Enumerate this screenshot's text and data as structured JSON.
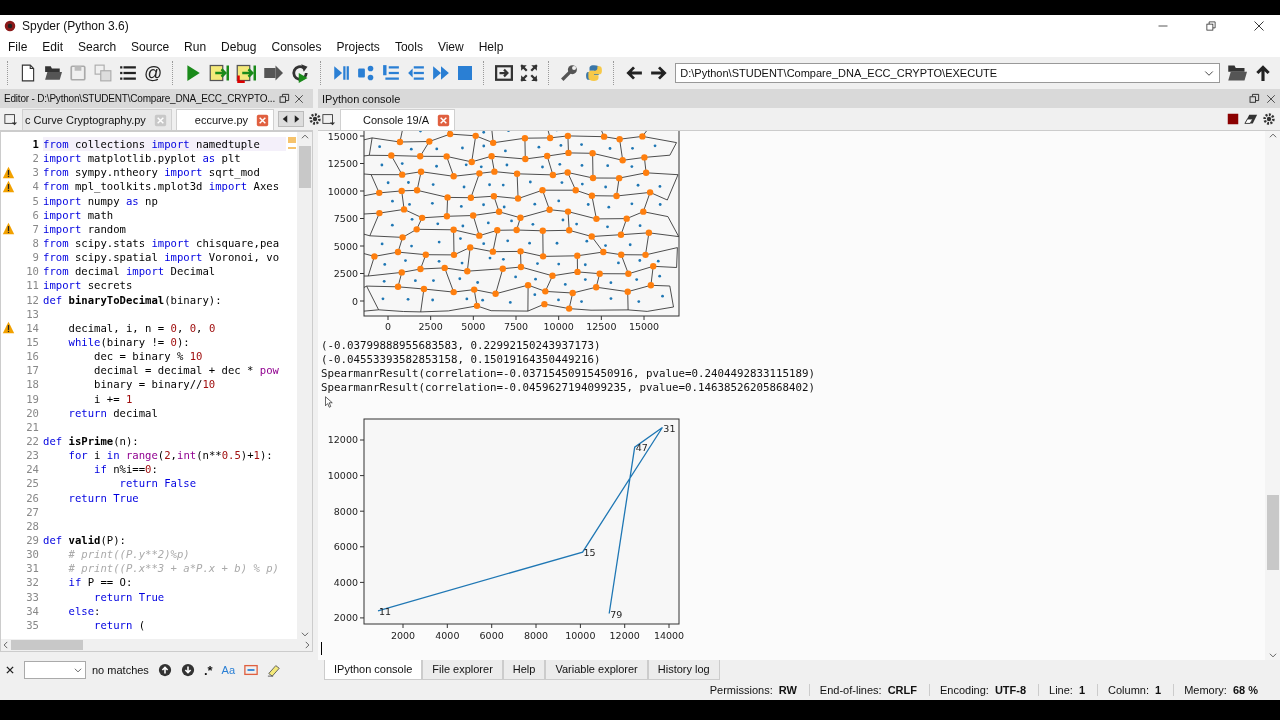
{
  "window": {
    "title": "Spyder (Python 3.6)"
  },
  "menu": [
    "File",
    "Edit",
    "Search",
    "Source",
    "Run",
    "Debug",
    "Consoles",
    "Projects",
    "Tools",
    "View",
    "Help"
  ],
  "toolbar": {
    "email_symbol": "@",
    "working_directory": "D:\\Python\\STUDENT\\Compare_DNA_ECC_CRYPTO\\EXECUTE"
  },
  "editor": {
    "title": "Editor - D:\\Python\\STUDENT\\Compare_DNA_ECC_CRYPTO...",
    "tabs": [
      {
        "label": "c Curve Cryptography.py",
        "selected": false
      },
      {
        "label": "eccurve.py",
        "selected": true
      }
    ],
    "lines": [
      {
        "n": "1",
        "current": true,
        "warning": false,
        "s": [
          {
            "t": "from",
            "kind": "keyword"
          },
          {
            "t": " collections "
          },
          {
            "t": "import",
            "kind": "keyword"
          },
          {
            "t": " namedtuple"
          }
        ]
      },
      {
        "n": "2",
        "current": false,
        "warning": false,
        "s": [
          {
            "t": "import",
            "kind": "keyword"
          },
          {
            "t": " matplotlib.pyplot "
          },
          {
            "t": "as",
            "kind": "keyword"
          },
          {
            "t": " plt"
          }
        ]
      },
      {
        "n": "3",
        "current": false,
        "warning": true,
        "s": [
          {
            "t": "from",
            "kind": "keyword"
          },
          {
            "t": " sympy.ntheory "
          },
          {
            "t": "import",
            "kind": "keyword"
          },
          {
            "t": " sqrt_mod"
          }
        ]
      },
      {
        "n": "4",
        "current": false,
        "warning": true,
        "s": [
          {
            "t": "from",
            "kind": "keyword"
          },
          {
            "t": " mpl_toolkits.mplot3d "
          },
          {
            "t": "import",
            "kind": "keyword"
          },
          {
            "t": " Axes"
          }
        ]
      },
      {
        "n": "5",
        "current": false,
        "warning": false,
        "s": [
          {
            "t": "import",
            "kind": "keyword"
          },
          {
            "t": " numpy "
          },
          {
            "t": "as",
            "kind": "keyword"
          },
          {
            "t": " np"
          }
        ]
      },
      {
        "n": "6",
        "current": false,
        "warning": false,
        "s": [
          {
            "t": "import",
            "kind": "keyword"
          },
          {
            "t": " math"
          }
        ]
      },
      {
        "n": "7",
        "current": false,
        "warning": true,
        "s": [
          {
            "t": "import",
            "kind": "keyword"
          },
          {
            "t": " random"
          }
        ]
      },
      {
        "n": "8",
        "current": false,
        "warning": false,
        "s": [
          {
            "t": "from",
            "kind": "keyword"
          },
          {
            "t": " scipy.stats "
          },
          {
            "t": "import",
            "kind": "keyword"
          },
          {
            "t": " chisquare,pea"
          }
        ]
      },
      {
        "n": "9",
        "current": false,
        "warning": false,
        "s": [
          {
            "t": "from",
            "kind": "keyword"
          },
          {
            "t": " scipy.spatial "
          },
          {
            "t": "import",
            "kind": "keyword"
          },
          {
            "t": " Voronoi, vo"
          }
        ]
      },
      {
        "n": "10",
        "current": false,
        "warning": false,
        "s": [
          {
            "t": "from",
            "kind": "keyword"
          },
          {
            "t": " decimal "
          },
          {
            "t": "import",
            "kind": "keyword"
          },
          {
            "t": " Decimal"
          }
        ]
      },
      {
        "n": "11",
        "current": false,
        "warning": false,
        "s": [
          {
            "t": "import",
            "kind": "keyword"
          },
          {
            "t": " secrets"
          }
        ]
      },
      {
        "n": "12",
        "current": false,
        "warning": false,
        "s": [
          {
            "t": "def ",
            "kind": "keyword"
          },
          {
            "t": "binaryToDecimal",
            "kind": "name"
          },
          {
            "t": "(binary):"
          }
        ]
      },
      {
        "n": "13",
        "current": false,
        "warning": false
      },
      {
        "n": "14",
        "current": false,
        "warning": true,
        "s": [
          {
            "t": "    decimal, i, n = "
          },
          {
            "t": "0",
            "kind": "number"
          },
          {
            "t": ", "
          },
          {
            "t": "0",
            "kind": "number"
          },
          {
            "t": ", "
          },
          {
            "t": "0",
            "kind": "number"
          }
        ]
      },
      {
        "n": "15",
        "current": false,
        "warning": false,
        "s": [
          {
            "t": "    while",
            "kind": "keyword"
          },
          {
            "t": "(binary != "
          },
          {
            "t": "0",
            "kind": "number"
          },
          {
            "t": "):"
          }
        ]
      },
      {
        "n": "16",
        "current": false,
        "warning": false,
        "s": [
          {
            "t": "        dec = binary % "
          },
          {
            "t": "10",
            "kind": "number"
          }
        ]
      },
      {
        "n": "17",
        "current": false,
        "warning": false,
        "s": [
          {
            "t": "        decimal = decimal + dec * "
          },
          {
            "t": "pow",
            "kind": "builtin"
          }
        ]
      },
      {
        "n": "18",
        "current": false,
        "warning": false,
        "s": [
          {
            "t": "        binary = binary//"
          },
          {
            "t": "10",
            "kind": "number"
          }
        ]
      },
      {
        "n": "19",
        "current": false,
        "warning": false,
        "s": [
          {
            "t": "        i += "
          },
          {
            "t": "1",
            "kind": "number"
          }
        ]
      },
      {
        "n": "20",
        "current": false,
        "warning": false,
        "s": [
          {
            "t": "    return",
            "kind": "keyword"
          },
          {
            "t": " decimal"
          }
        ]
      },
      {
        "n": "21",
        "current": false,
        "warning": false
      },
      {
        "n": "22",
        "current": false,
        "warning": false,
        "s": [
          {
            "t": "def ",
            "kind": "keyword"
          },
          {
            "t": "isPrime",
            "kind": "name"
          },
          {
            "t": "(n):"
          }
        ]
      },
      {
        "n": "23",
        "current": false,
        "warning": false,
        "s": [
          {
            "t": "    for",
            "kind": "keyword"
          },
          {
            "t": " i "
          },
          {
            "t": "in ",
            "kind": "keyword"
          },
          {
            "t": "range",
            "kind": "builtin"
          },
          {
            "t": "("
          },
          {
            "t": "2",
            "kind": "number"
          },
          {
            "t": ","
          },
          {
            "t": "int",
            "kind": "builtin"
          },
          {
            "t": "(n**"
          },
          {
            "t": "0.5",
            "kind": "number"
          },
          {
            "t": ")+"
          },
          {
            "t": "1",
            "kind": "number"
          },
          {
            "t": "):"
          }
        ]
      },
      {
        "n": "24",
        "current": false,
        "warning": false,
        "s": [
          {
            "t": "        if",
            "kind": "keyword"
          },
          {
            "t": " n%i=="
          },
          {
            "t": "0",
            "kind": "number"
          },
          {
            "t": ":"
          }
        ]
      },
      {
        "n": "25",
        "current": false,
        "warning": false,
        "s": [
          {
            "t": "            return False",
            "kind": "keyword"
          }
        ]
      },
      {
        "n": "26",
        "current": false,
        "warning": false,
        "s": [
          {
            "t": "    return True",
            "kind": "keyword"
          }
        ]
      },
      {
        "n": "27",
        "current": false,
        "warning": false
      },
      {
        "n": "28",
        "current": false,
        "warning": false
      },
      {
        "n": "29",
        "current": false,
        "warning": false,
        "s": [
          {
            "t": "def ",
            "kind": "keyword"
          },
          {
            "t": "valid",
            "kind": "name"
          },
          {
            "t": "(P):"
          }
        ]
      },
      {
        "n": "30",
        "current": false,
        "warning": false,
        "s": [
          {
            "t": "    # print((P.y**2)%p)",
            "kind": "comment"
          }
        ]
      },
      {
        "n": "31",
        "current": false,
        "warning": false,
        "s": [
          {
            "t": "    # print((P.x**3 + a*P.x + b) % p)",
            "kind": "comment"
          }
        ]
      },
      {
        "n": "32",
        "current": false,
        "warning": false,
        "s": [
          {
            "t": "    if",
            "kind": "keyword"
          },
          {
            "t": " P == O:"
          }
        ]
      },
      {
        "n": "33",
        "current": false,
        "warning": false,
        "s": [
          {
            "t": "        return True",
            "kind": "keyword"
          }
        ]
      },
      {
        "n": "34",
        "current": false,
        "warning": false,
        "s": [
          {
            "t": "    else",
            "kind": "keyword"
          },
          {
            "t": ":"
          }
        ]
      },
      {
        "n": "35",
        "current": false,
        "warning": false,
        "s": [
          {
            "t": "        return",
            "kind": "keyword"
          },
          {
            "t": " ("
          }
        ]
      }
    ]
  },
  "console_pane": {
    "title": "IPython console",
    "tabs": [
      {
        "label": "Console 19/A",
        "selected": true
      }
    ],
    "voronoi_plot": {
      "x_tick_labels": [
        "0",
        "2500",
        "5000",
        "7500",
        "10000",
        "12500",
        "15000"
      ],
      "y_tick_labels": [
        "15000",
        "12500",
        "10000",
        "7500",
        "5000",
        "2500",
        "0"
      ]
    },
    "output": [
      "(-0.03799888955683583, 0.22992150243937173)",
      "(-0.04553393582853158, 0.15019164350449216)",
      "SpearmanrResult(correlation=-0.03715450915450916, pvalue=0.2404492833115189)",
      "SpearmanrResult(correlation=-0.0459627194099235, pvalue=0.14638526205868402)"
    ],
    "chart_data": {
      "type": "line",
      "x": [
        870,
        10100,
        13700,
        12450,
        11300
      ],
      "series": [
        {
          "color": "#1f77b4",
          "values": [
            2400,
            5700,
            12700,
            11600,
            2250
          ]
        }
      ],
      "xlim": [
        240,
        14450
      ],
      "ylim": [
        1660,
        13180
      ],
      "xticks": [
        2000,
        4000,
        6000,
        8000,
        10000,
        12000,
        14000
      ],
      "yticks": [
        2000,
        4000,
        6000,
        8000,
        10000,
        12000
      ],
      "annotations": [
        {
          "x": 870,
          "y": 2400,
          "text": "11"
        },
        {
          "x": 10100,
          "y": 5700,
          "text": "15"
        },
        {
          "x": 13700,
          "y": 12700,
          "text": "31"
        },
        {
          "x": 12450,
          "y": 11600,
          "text": "47"
        },
        {
          "x": 11300,
          "y": 2250,
          "text": "79"
        }
      ]
    }
  },
  "find_bar": {
    "status": "no matches",
    "regex_toggle": ".*",
    "case_toggle": "Aa"
  },
  "bottom_tabs": [
    {
      "label": "IPython console",
      "selected": true
    },
    {
      "label": "File explorer",
      "selected": false
    },
    {
      "label": "Help",
      "selected": false
    },
    {
      "label": "Variable explorer",
      "selected": false
    },
    {
      "label": "History log",
      "selected": false
    }
  ],
  "status_bar": [
    {
      "label": "Permissions:",
      "value": "RW"
    },
    {
      "label": "End-of-lines:",
      "value": "CRLF"
    },
    {
      "label": "Encoding:",
      "value": "UTF-8"
    },
    {
      "label": "Line:",
      "value": "1"
    },
    {
      "label": "Column:",
      "value": "1"
    },
    {
      "label": "Memory:",
      "value": "68 %"
    }
  ]
}
